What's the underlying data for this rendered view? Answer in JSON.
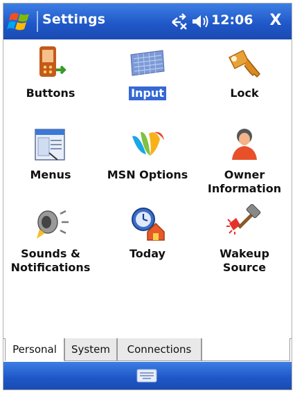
{
  "titlebar": {
    "title": "Settings",
    "time": "12:06",
    "close_glyph": "X",
    "icons": [
      "windows-start-icon",
      "connectivity-icon",
      "volume-icon"
    ]
  },
  "items": [
    {
      "label": "Buttons",
      "icon": "buttons-icon",
      "selected": false
    },
    {
      "label": "Input",
      "icon": "input-icon",
      "selected": true
    },
    {
      "label": "Lock",
      "icon": "lock-icon",
      "selected": false
    },
    {
      "label": "Menus",
      "icon": "menus-icon",
      "selected": false
    },
    {
      "label": "MSN Options",
      "icon": "msn-options-icon",
      "selected": false
    },
    {
      "label_line1": "Owner",
      "label_line2": "Information",
      "icon": "owner-information-icon",
      "selected": false
    },
    {
      "label_line1": "Sounds &",
      "label_line2": "Notifications",
      "icon": "sounds-notifications-icon",
      "selected": false
    },
    {
      "label": "Today",
      "icon": "today-icon",
      "selected": false
    },
    {
      "label_line1": "Wakeup",
      "label_line2": "Source",
      "icon": "wakeup-source-icon",
      "selected": false
    }
  ],
  "tabs": [
    {
      "label": "Personal",
      "active": true
    },
    {
      "label": "System",
      "active": false
    },
    {
      "label": "Connections",
      "active": false
    }
  ],
  "bottombar": {
    "icon": "keyboard-icon"
  },
  "colors": {
    "titlebar": "#1f56c6",
    "selection": "#3468d6"
  }
}
